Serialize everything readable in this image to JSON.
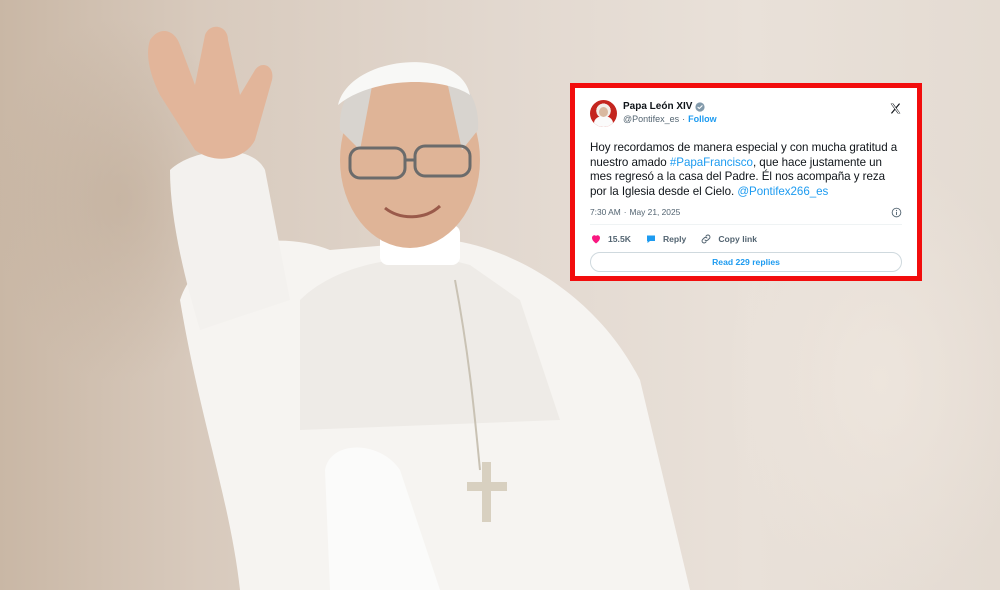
{
  "tweet": {
    "display_name": "Papa León XIV",
    "handle": "@Pontifex_es",
    "separator": "·",
    "follow_label": "Follow",
    "text_segments": {
      "t1": "Hoy recordamos de manera especial y con mucha gratitud a nuestro amado ",
      "hashtag": "#PapaFrancisco",
      "t2": ", que hace justamente un mes regresó a la casa del Padre. Él nos acompaña y reza por la Iglesia desde el Cielo. ",
      "mention": "@Pontifex266_es"
    },
    "time": "7:30 AM",
    "date": "May 21, 2025",
    "likes": "15.5K",
    "reply_label": "Reply",
    "copy_link_label": "Copy link",
    "read_replies_label": "Read 229 replies",
    "icons": {
      "verified": "verified-badge-icon",
      "x_logo": "x-logo-icon",
      "info": "info-icon",
      "like": "heart-icon",
      "reply": "reply-bubble-icon",
      "copy": "link-icon"
    }
  },
  "colors": {
    "highlight_border": "#f20d0d",
    "link": "#1d9bf0",
    "like": "#f91880",
    "text": "#0f1419",
    "muted": "#536471"
  }
}
